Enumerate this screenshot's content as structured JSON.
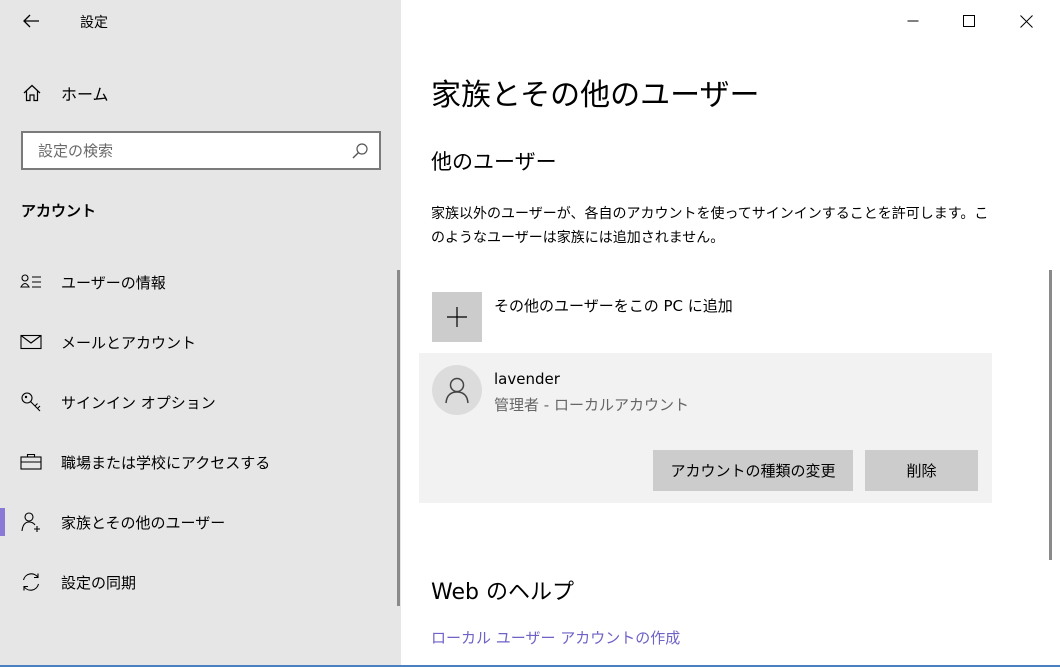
{
  "window": {
    "title": "設定",
    "accent_color": "#8a7ad6",
    "link_color": "#6e62c6"
  },
  "sidebar": {
    "back_icon": "back-arrow-icon",
    "home": {
      "label": "ホーム",
      "icon": "home-icon"
    },
    "search": {
      "placeholder": "設定の検索",
      "icon": "search-icon"
    },
    "section_heading": "アカウント",
    "items": [
      {
        "label": "ユーザーの情報",
        "icon": "user-info-icon",
        "selected": false
      },
      {
        "label": "メールとアカウント",
        "icon": "mail-icon",
        "selected": false
      },
      {
        "label": "サインイン オプション",
        "icon": "key-icon",
        "selected": false
      },
      {
        "label": "職場または学校にアクセスする",
        "icon": "briefcase-icon",
        "selected": false
      },
      {
        "label": "家族とその他のユーザー",
        "icon": "person-add-icon",
        "selected": true
      },
      {
        "label": "設定の同期",
        "icon": "sync-icon",
        "selected": false
      }
    ]
  },
  "main": {
    "title": "家族とその他のユーザー",
    "other_users": {
      "heading": "他のユーザー",
      "description": "家族以外のユーザーが、各自のアカウントを使ってサインインすることを許可します。このようなユーザーは家族には追加されません。",
      "add_label": "その他のユーザーをこの PC に追加",
      "user": {
        "name": "lavender",
        "role": "管理者 - ローカルアカウント",
        "change_button": "アカウントの種類の変更",
        "remove_button": "削除"
      }
    },
    "help": {
      "heading": "Web のヘルプ",
      "links": [
        "ローカル ユーザー アカウントの作成"
      ]
    }
  }
}
